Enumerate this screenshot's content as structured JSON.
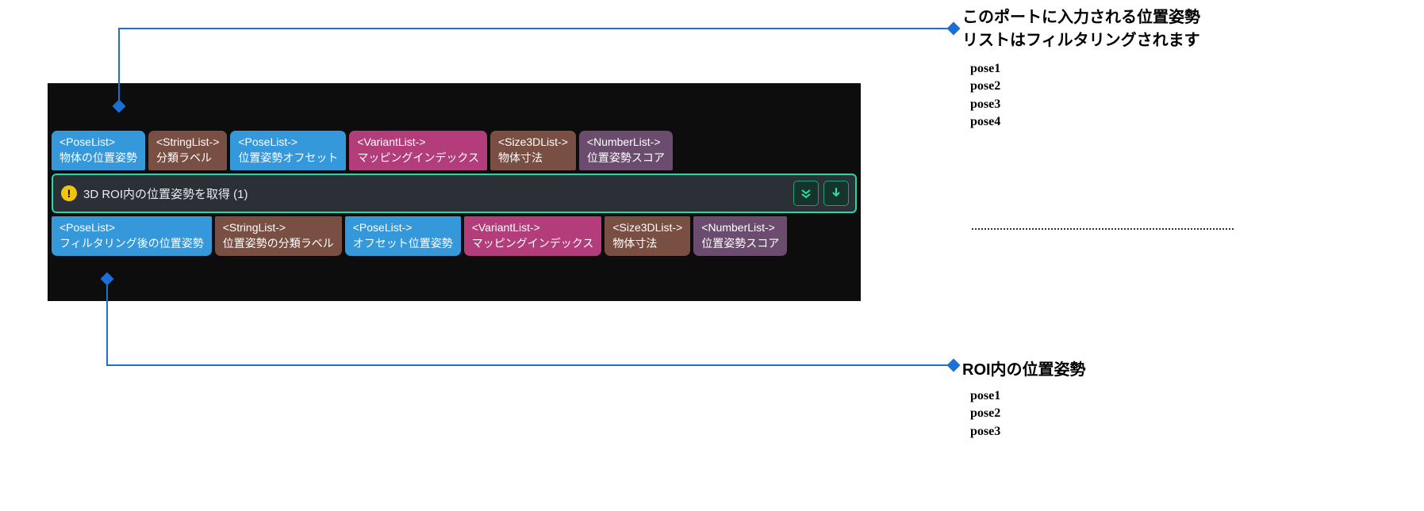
{
  "annotations": {
    "top": {
      "title": "このポートに入力される位置姿勢\nリストはフィルタリングされます",
      "poses": [
        "pose1",
        "pose2",
        "pose3",
        "pose4"
      ]
    },
    "bottom": {
      "title": "ROI内の位置姿勢",
      "poses": [
        "pose1",
        "pose2",
        "pose3"
      ]
    }
  },
  "node": {
    "title": "3D ROI内の位置姿勢を取得 (1)",
    "warn": "!"
  },
  "ports": {
    "in": [
      {
        "type": "<PoseList>",
        "label": "物体の位置姿勢",
        "color": "c-blue"
      },
      {
        "type": "<StringList->",
        "label": "分類ラベル",
        "color": "c-brown"
      },
      {
        "type": "<PoseList->",
        "label": "位置姿勢オフセット",
        "color": "c-blue"
      },
      {
        "type": "<VariantList->",
        "label": "マッピングインデックス",
        "color": "c-pink"
      },
      {
        "type": "<Size3DList->",
        "label": "物体寸法",
        "color": "c-brown"
      },
      {
        "type": "<NumberList->",
        "label": "位置姿勢スコア",
        "color": "c-purple"
      }
    ],
    "out": [
      {
        "type": "<PoseList>",
        "label": "フィルタリング後の位置姿勢",
        "color": "c-blue"
      },
      {
        "type": "<StringList->",
        "label": "位置姿勢の分類ラベル",
        "color": "c-brown"
      },
      {
        "type": "<PoseList->",
        "label": "オフセット位置姿勢",
        "color": "c-blue"
      },
      {
        "type": "<VariantList->",
        "label": "マッピングインデックス",
        "color": "c-pink"
      },
      {
        "type": "<Size3DList->",
        "label": "物体寸法",
        "color": "c-brown"
      },
      {
        "type": "<NumberList->",
        "label": "位置姿勢スコア",
        "color": "c-purple"
      }
    ]
  }
}
